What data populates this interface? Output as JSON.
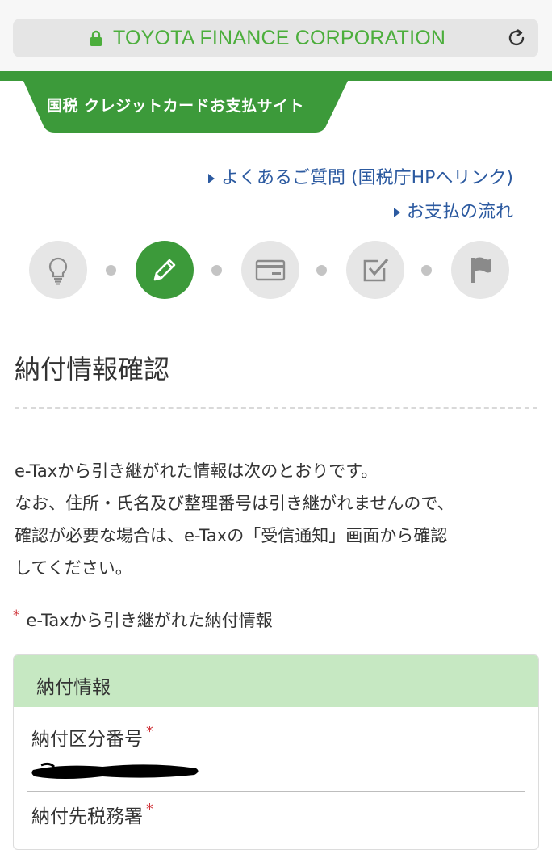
{
  "browser": {
    "url_label": "TOYOTA FINANCE CORPORATION"
  },
  "site": {
    "tab_label": "国税 クレジットカードお支払サイト"
  },
  "links": [
    {
      "label": "よくあるご質問 (国税庁HPへリンク)"
    },
    {
      "label": "お支払の流れ"
    }
  ],
  "steps": [
    {
      "icon": "lightbulb-icon",
      "active": false
    },
    {
      "icon": "pencil-icon",
      "active": true
    },
    {
      "icon": "credit-card-icon",
      "active": false
    },
    {
      "icon": "checkbox-icon",
      "active": false
    },
    {
      "icon": "flag-icon",
      "active": false
    }
  ],
  "page": {
    "title": "納付情報確認",
    "intro_lines": [
      "e-Taxから引き継がれた情報は次のとおりです。",
      "なお、住所・氏名及び整理番号は引き継がれませんので、",
      "確認が必要な場合は、e-Taxの「受信通知」画面から確認",
      "してください。"
    ],
    "note": "e-Taxから引き継がれた納付情報",
    "required_mark": "*"
  },
  "panel": {
    "header": "納付情報",
    "fields": [
      {
        "label": "納付区分番号"
      },
      {
        "label": "納付先税務署"
      }
    ]
  },
  "colors": {
    "brand_green": "#3c9a3a",
    "link_blue": "#2c5aa0",
    "required_red": "#d0353b",
    "panel_header": "#c6e8c2"
  }
}
